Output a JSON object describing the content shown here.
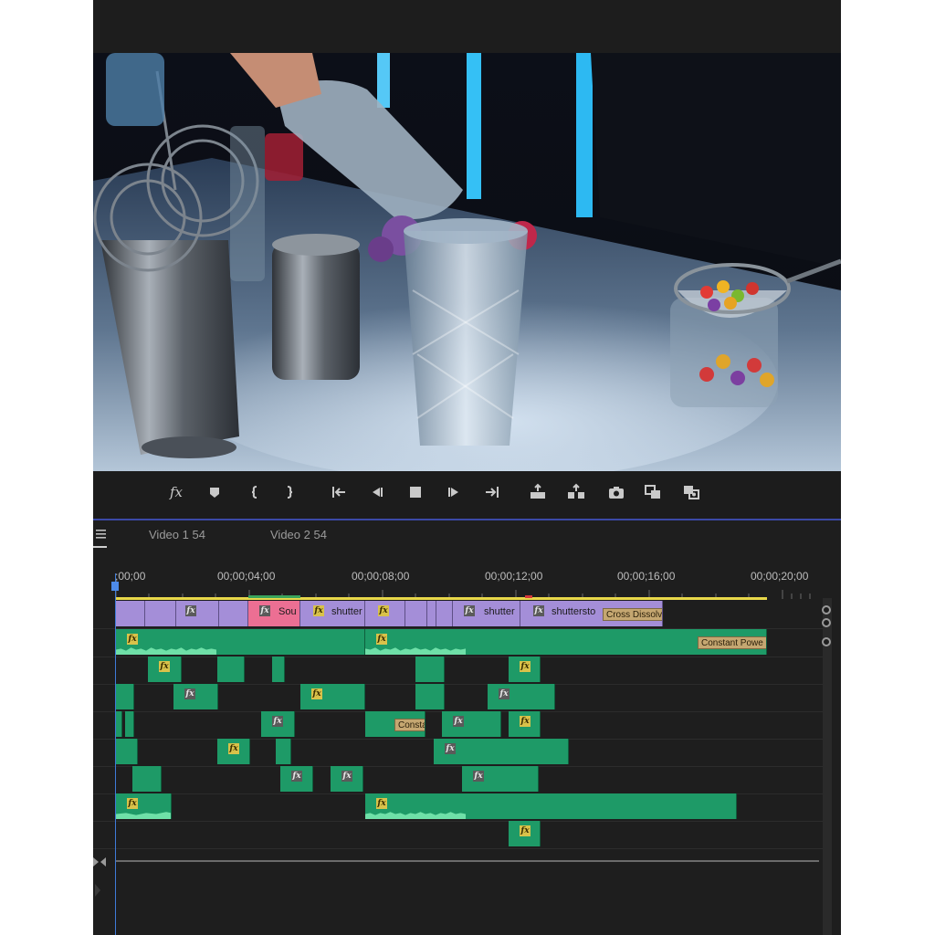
{
  "controls": {
    "fx_label": "fx"
  },
  "timeline": {
    "tabs": [
      "Video 1 54",
      "Video 2 54"
    ],
    "timecodes": [
      ";00;00",
      "00;00;04;00",
      "00;00;08;00",
      "00;00;12;00",
      "00;00;16;00",
      "00;00;20;00"
    ],
    "video_clip_labels": [
      "Sou",
      "shutter",
      "shutter",
      "shuttersto"
    ],
    "transitions": [
      "Cross Dissolv",
      "Constant Powe",
      "Consta"
    ],
    "fx_label": "fx"
  },
  "colors": {
    "video_clip": "#a48ed8",
    "pink_clip": "#ec6f93",
    "audio_clip": "#1e9a67",
    "playhead": "#3f7bd8",
    "work_area": "#e8d84a"
  },
  "icons": [
    "menu-icon",
    "fx-icon",
    "add-marker-icon",
    "mark-in-icon",
    "mark-out-icon",
    "go-to-in-icon",
    "step-back-icon",
    "stop-icon",
    "step-forward-icon",
    "go-to-out-icon",
    "lift-icon",
    "extract-icon",
    "export-frame-icon",
    "comparison-view-icon",
    "multi-camera-icon"
  ]
}
